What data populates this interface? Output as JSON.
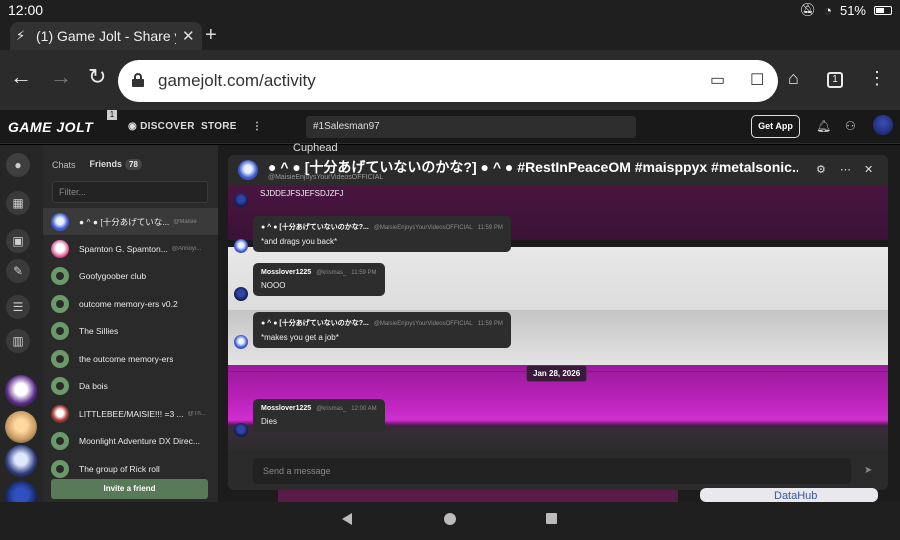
{
  "status_bar": {
    "time": "12:00",
    "battery": "51%"
  },
  "browser": {
    "tab_title": "(1) Game Jolt - Share y",
    "url": "gamejolt.com/activity",
    "tab_count": "1"
  },
  "gj_nav": {
    "logo": "GAME JOLT",
    "logo_badge": "1",
    "discover": "DISCOVER",
    "store": "STORE",
    "search_value": "#1Salesman97",
    "get_app": "Get App"
  },
  "background": {
    "cuphead": "Cuphead",
    "datahub": "DataHub"
  },
  "chats": {
    "tab_chats": "Chats",
    "tab_friends": "Friends",
    "friends_count": "78",
    "filter_placeholder": "Filter...",
    "invite": "Invite a friend",
    "items": [
      {
        "name": "● ^ ● [十分あげていな...",
        "handle": "@Maisie"
      },
      {
        "name": "Spamton G. Spamton...",
        "handle": "@Annoyi..."
      },
      {
        "name": "Goofygoober club",
        "handle": ""
      },
      {
        "name": "outcome memory-ers v0.2",
        "handle": ""
      },
      {
        "name": "The Sillies",
        "handle": ""
      },
      {
        "name": "the outcome memory-ers",
        "handle": ""
      },
      {
        "name": "Da bois",
        "handle": ""
      },
      {
        "name": "LITTLEBEE/MAISIE!!! =3 ...",
        "handle": "@Th..."
      },
      {
        "name": "Moonlight Adventure DX Direc...",
        "handle": ""
      },
      {
        "name": "The group of Rick roll",
        "handle": ""
      }
    ]
  },
  "chat_window": {
    "title": "● ^ ● [十分あげていないのかな?] ● ^ ● #RestInPeaceOM #maisppyx #metalsonic...",
    "subtitle": "@MaisieEnjoysYourVideosOFFICIAL",
    "first_text": "SJDDEJFSJEFSDJZFJ",
    "date_divider": "Jan 28, 2026",
    "input_placeholder": "Send a message",
    "messages": [
      {
        "name": "● ^ ● [十分あげていないのかな?...",
        "handle": "@MaisieEnjoysYourVideosOFFICIAL",
        "time": "11:59 PM",
        "text": "*and drags you back*"
      },
      {
        "name": "Mosslover1225",
        "handle": "@krismas_",
        "time": "11:59 PM",
        "text": "NOOO"
      },
      {
        "name": "● ^ ● [十分あげていないのかな?...",
        "handle": "@MaisieEnjoysYourVideosOFFICIAL",
        "time": "11:59 PM",
        "text": "*makes you get a job*"
      },
      {
        "name": "Mosslover1225",
        "handle": "@krismas_",
        "time": "12:00 AM",
        "text": "Dies"
      }
    ]
  },
  "colors": {
    "accent_green": "#6ce56c",
    "invite_button": "#597a59",
    "chat_purple": "#b520b5"
  }
}
